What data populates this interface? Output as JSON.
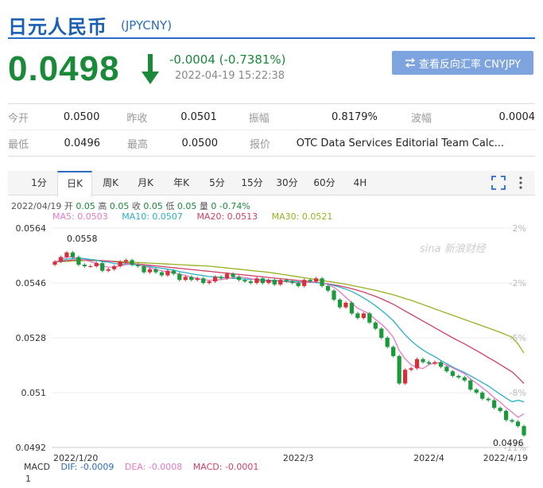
{
  "header": {
    "title": "日元人民币",
    "code": "(JPYCNY)"
  },
  "quote": {
    "price": "0.0498",
    "change": "-0.0004 (-0.7381%)",
    "timestamp": "2022-04-19 15:22:38",
    "reverse_button": "查看反向汇率 CNYJPY",
    "down_color": "#1a8a3a"
  },
  "stats": {
    "row1": [
      {
        "label": "今开",
        "value": "0.0500"
      },
      {
        "label": "昨收",
        "value": "0.0501"
      },
      {
        "label": "振幅",
        "value": "0.8179%"
      },
      {
        "label": "波幅",
        "value": "0.0004"
      }
    ],
    "row2": [
      {
        "label": "最低",
        "value": "0.0496"
      },
      {
        "label": "最高",
        "value": "0.0500"
      },
      {
        "label": "报价",
        "value": "OTC Data Services Editorial Team Calc..."
      }
    ]
  },
  "tabs": [
    "1分",
    "日K",
    "周K",
    "月K",
    "年K",
    "5分",
    "15分",
    "30分",
    "60分",
    "4H"
  ],
  "active_tab": "日K",
  "ohlc": {
    "date": "2022/04/19",
    "open_label": "开",
    "open": "0.05",
    "high_label": "高",
    "high": "0.05",
    "close_label": "收",
    "close": "0.05",
    "low_label": "低",
    "low": "0.05",
    "vol_label": "量",
    "vol": "0",
    "pct": "-0.74%"
  },
  "ma": [
    {
      "label": "MA5: 0.0503",
      "color": "#e678c8"
    },
    {
      "label": "MA10: 0.0507",
      "color": "#2ab0c8"
    },
    {
      "label": "MA20: 0.0513",
      "color": "#d0406a"
    },
    {
      "label": "MA30: 0.0521",
      "color": "#9ab020"
    }
  ],
  "macd": {
    "label": "MACD",
    "dif": "DIF: -0.0009",
    "dea": "DEA: -0.0008",
    "macd": "MACD: -0.0001",
    "scale": "1"
  },
  "chart_data": {
    "type": "candlestick",
    "y_ticks": [
      "0.0564",
      "0.0546",
      "0.0528",
      "0.051",
      "0.0492"
    ],
    "y_tick_values": [
      0.0564,
      0.0546,
      0.0528,
      0.051,
      0.0492
    ],
    "pct_ticks": [
      "2%",
      "-2%",
      "-5%",
      "-8%",
      "-11%"
    ],
    "x_ticks": [
      "2022/1/20",
      "2022/3",
      "2022/4",
      "2022/4/19"
    ],
    "x_tick_index": [
      0,
      41,
      63,
      79
    ],
    "high_marker": "0.0558",
    "low_marker": "0.0496",
    "watermark": "sina 新浪财经",
    "ylim": [
      0.0492,
      0.0564
    ],
    "up_color": "#d8303a",
    "down_color": "#1a9a3a",
    "close": [
      0.0553,
      0.05545,
      0.0556,
      0.05545,
      0.0552,
      0.05515,
      0.05515,
      0.05525,
      0.055,
      0.05505,
      0.05515,
      0.0553,
      0.05535,
      0.0552,
      0.05515,
      0.05495,
      0.05505,
      0.05495,
      0.05485,
      0.055,
      0.0549,
      0.0547,
      0.0548,
      0.0547,
      0.05475,
      0.0546,
      0.05465,
      0.0548,
      0.05475,
      0.0549,
      0.0548,
      0.0547,
      0.05465,
      0.0546,
      0.05475,
      0.0546,
      0.0547,
      0.05455,
      0.0547,
      0.05465,
      0.0546,
      0.0545,
      0.0547,
      0.05465,
      0.05475,
      0.0545,
      0.05435,
      0.05405,
      0.0538,
      0.05395,
      0.0536,
      0.05345,
      0.0536,
      0.0533,
      0.0531,
      0.0528,
      0.0525,
      0.0522,
      0.0513,
      0.05175,
      0.0518,
      0.0521,
      0.052,
      0.05195,
      0.052,
      0.05185,
      0.0517,
      0.05155,
      0.0515,
      0.0514,
      0.0511,
      0.051,
      0.0508,
      0.05075,
      0.0505,
      0.0504,
      0.0501,
      0.05005,
      0.0499,
      0.0496
    ],
    "ma5": [
      0.0553,
      0.05535,
      0.05545,
      0.05545,
      0.0554,
      0.05535,
      0.0553,
      0.05525,
      0.05515,
      0.05512,
      0.05512,
      0.05517,
      0.0552,
      0.05522,
      0.05522,
      0.05515,
      0.0551,
      0.05505,
      0.055,
      0.05496,
      0.05495,
      0.05488,
      0.05485,
      0.05478,
      0.05475,
      0.05471,
      0.05468,
      0.0547,
      0.05471,
      0.05474,
      0.05478,
      0.0548,
      0.05478,
      0.05474,
      0.0547,
      0.05466,
      0.05466,
      0.05464,
      0.05466,
      0.05464,
      0.05462,
      0.0546,
      0.05462,
      0.05462,
      0.05464,
      0.0546,
      0.05455,
      0.05446,
      0.05431,
      0.05413,
      0.05395,
      0.05377,
      0.05368,
      0.05358,
      0.0534,
      0.05325,
      0.05306,
      0.05282,
      0.05238,
      0.05211,
      0.05191,
      0.05183,
      0.05179,
      0.05192,
      0.05197,
      0.05198,
      0.0519,
      0.05181,
      0.05172,
      0.05162,
      0.05145,
      0.05131,
      0.05116,
      0.05101,
      0.05083,
      0.05069,
      0.05051,
      0.05036,
      0.05019,
      0.0503
    ],
    "ma10": [
      0.0553,
      0.05532,
      0.05538,
      0.0554,
      0.05541,
      0.0554,
      0.05537,
      0.05535,
      0.0553,
      0.05528,
      0.05524,
      0.05522,
      0.05522,
      0.0552,
      0.05519,
      0.05516,
      0.05514,
      0.05511,
      0.05508,
      0.05505,
      0.05502,
      0.05497,
      0.05494,
      0.0549,
      0.05487,
      0.05484,
      0.05481,
      0.0548,
      0.05478,
      0.05477,
      0.05475,
      0.05474,
      0.05473,
      0.05472,
      0.05472,
      0.0547,
      0.05469,
      0.05468,
      0.05467,
      0.05466,
      0.05465,
      0.05464,
      0.05463,
      0.05462,
      0.05461,
      0.05459,
      0.05456,
      0.05452,
      0.05446,
      0.0544,
      0.05432,
      0.05422,
      0.05411,
      0.05399,
      0.05385,
      0.0537,
      0.05354,
      0.05336,
      0.05312,
      0.0529,
      0.0527,
      0.05254,
      0.0524,
      0.05228,
      0.05218,
      0.05206,
      0.05195,
      0.05184,
      0.05175,
      0.05166,
      0.05155,
      0.05144,
      0.05133,
      0.05122,
      0.05108,
      0.05095,
      0.05082,
      0.0507,
      0.05075,
      0.0507
    ],
    "ma20": [
      0.0553,
      0.05531,
      0.05533,
      0.05535,
      0.05536,
      0.05536,
      0.05535,
      0.05534,
      0.05533,
      0.05532,
      0.0553,
      0.05528,
      0.05526,
      0.05524,
      0.05522,
      0.0552,
      0.05518,
      0.05516,
      0.05514,
      0.05512,
      0.0551,
      0.05508,
      0.05506,
      0.05504,
      0.05502,
      0.055,
      0.05498,
      0.05496,
      0.05494,
      0.05492,
      0.0549,
      0.05488,
      0.05486,
      0.05484,
      0.05482,
      0.0548,
      0.05478,
      0.05476,
      0.05474,
      0.05472,
      0.0547,
      0.05468,
      0.05466,
      0.05464,
      0.05462,
      0.0546,
      0.05457,
      0.05454,
      0.0545,
      0.05446,
      0.05441,
      0.05436,
      0.0543,
      0.05423,
      0.05416,
      0.05408,
      0.05399,
      0.0539,
      0.05379,
      0.05368,
      0.05357,
      0.05346,
      0.05335,
      0.05324,
      0.05313,
      0.05302,
      0.05291,
      0.0528,
      0.0527,
      0.0526,
      0.05249,
      0.05238,
      0.05227,
      0.05215,
      0.05204,
      0.05192,
      0.0518,
      0.05168,
      0.0515,
      0.0513
    ],
    "ma30": [
      0.0553,
      0.0553,
      0.05531,
      0.05532,
      0.05533,
      0.05533,
      0.05533,
      0.05533,
      0.05533,
      0.05532,
      0.05531,
      0.0553,
      0.05529,
      0.05528,
      0.05527,
      0.05526,
      0.05525,
      0.05524,
      0.05523,
      0.05522,
      0.05521,
      0.0552,
      0.05519,
      0.05518,
      0.05517,
      0.05516,
      0.05515,
      0.05513,
      0.05511,
      0.05509,
      0.05507,
      0.05505,
      0.05503,
      0.05501,
      0.05499,
      0.05497,
      0.05495,
      0.05492,
      0.05489,
      0.05486,
      0.05483,
      0.0548,
      0.05477,
      0.05474,
      0.05471,
      0.05468,
      0.05465,
      0.05462,
      0.05459,
      0.05456,
      0.05452,
      0.05448,
      0.05444,
      0.0544,
      0.05436,
      0.05431,
      0.05426,
      0.05421,
      0.05415,
      0.05409,
      0.05403,
      0.05396,
      0.05389,
      0.05382,
      0.05375,
      0.05368,
      0.05361,
      0.05354,
      0.05347,
      0.0534,
      0.05333,
      0.05326,
      0.05319,
      0.05312,
      0.05305,
      0.05298,
      0.0529,
      0.05282,
      0.0526,
      0.0523
    ]
  }
}
